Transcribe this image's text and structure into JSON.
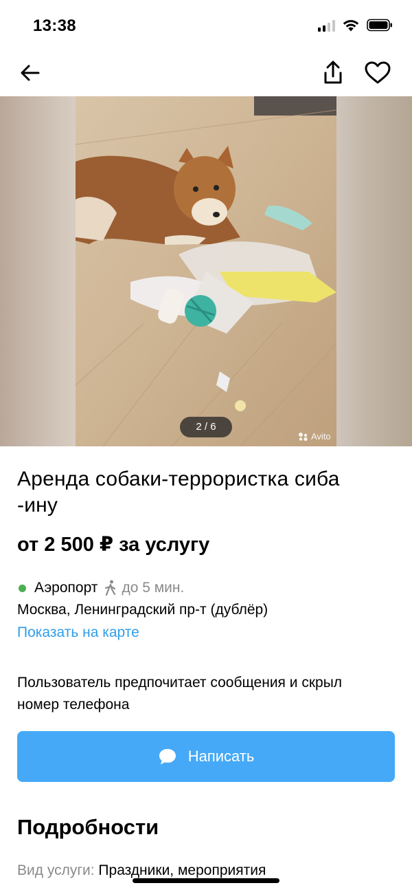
{
  "status": {
    "time": "13:38"
  },
  "nav": {
    "back_icon": "arrow-left-icon",
    "share_icon": "share-icon",
    "favorite_icon": "heart-icon"
  },
  "gallery": {
    "counter": "2 / 6",
    "watermark": "Avito"
  },
  "listing": {
    "title_line1": "Аренда собаки-террористка сиба",
    "title_line2": "-ину",
    "price": "от 2 500 ₽ за услугу",
    "metro_station": "Аэропорт",
    "metro_time": "до 5 мин.",
    "address": "Москва, Ленинградский пр-т (дублёр)",
    "map_link": "Показать на карте",
    "contact_note_line1": "Пользователь предпочитает сообщения и скрыл",
    "contact_note_line2": "номер телефона",
    "write_button": "Написать",
    "details_heading": "Подробности",
    "service_type_key": "Вид услуги:",
    "service_type_value": "Праздники, мероприятия"
  },
  "colors": {
    "accent": "#45a9f7",
    "link": "#2f9ee8",
    "metro_line": "#4caf50",
    "muted_text": "#8a8a8a"
  }
}
